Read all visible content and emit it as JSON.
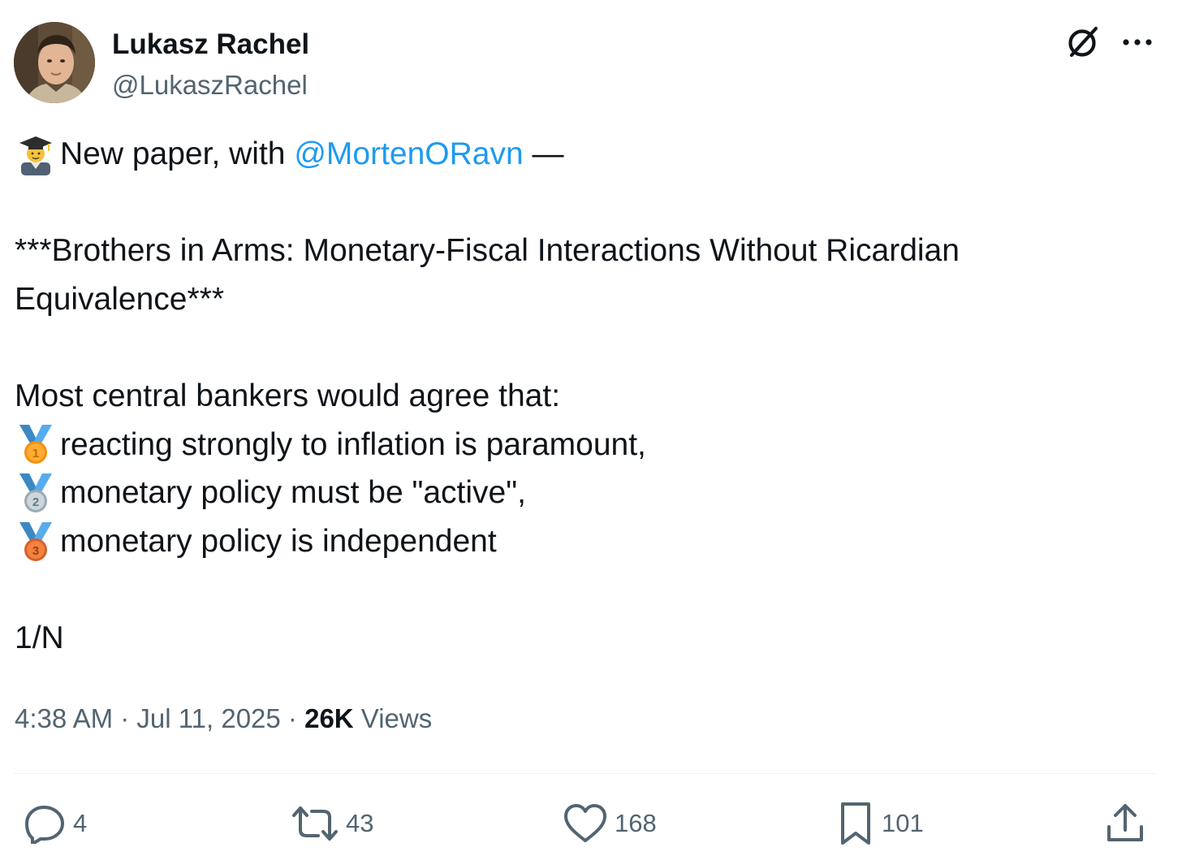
{
  "author": {
    "display_name": "Lukasz Rachel",
    "handle": "@LukaszRachel"
  },
  "header_icons": [
    "grok-icon",
    "more-options-icon"
  ],
  "tweet": {
    "lines": [
      {
        "emoji": "graduate-emoji",
        "prefix": "New paper, with ",
        "mention": "@MortenORavn",
        "suffix": " —"
      },
      {
        "text": "***Brothers in Arms: Monetary-Fiscal Interactions Without Ricardian"
      },
      {
        "text": "Equivalence***"
      },
      {
        "text": "Most central bankers would agree that:"
      },
      {
        "emoji": "first-place-medal-emoji",
        "text": "reacting strongly to inflation is paramount,"
      },
      {
        "emoji": "second-place-medal-emoji",
        "text": "monetary policy must be \"active\","
      },
      {
        "emoji": "third-place-medal-emoji",
        "text": "monetary policy is independent"
      },
      {
        "text": "1/N"
      }
    ]
  },
  "meta": {
    "time": "4:38 AM",
    "date": "Jul 11, 2025",
    "separator": " · ",
    "views_count": "26K",
    "views_label": " Views"
  },
  "actions": {
    "replies": "4",
    "reposts": "43",
    "likes": "168",
    "bookmarks": "101"
  },
  "colors": {
    "text": "#0f1419",
    "secondary": "#536471",
    "link": "#1d9bf0",
    "divider": "#eff3f4"
  }
}
